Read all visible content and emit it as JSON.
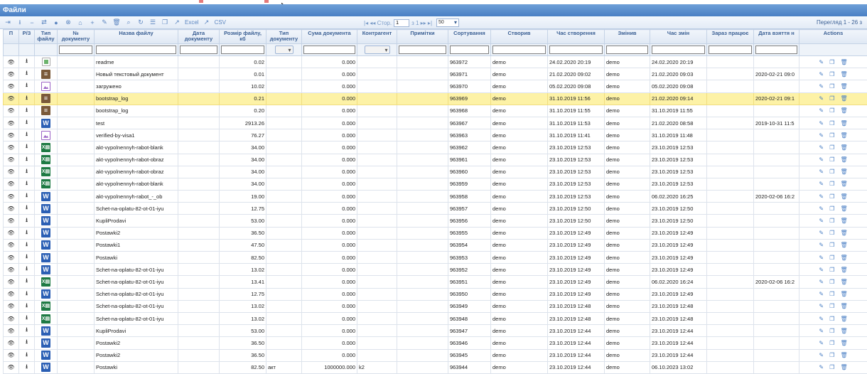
{
  "page": {
    "title": "Файли"
  },
  "toolbar": {
    "excel": "Excel",
    "csv": "CSV",
    "page_label": "Стор.",
    "page_value": "1",
    "page_of": "з 1",
    "page_size": "50",
    "viewing": "Перегляд 1 - 26 з"
  },
  "columns": {
    "p": "П",
    "rz": "Р/З",
    "type": "Тип файлу",
    "docnum": "№ документу",
    "name": "Назва файлу",
    "docdate": "Дата документу",
    "size": "Розмір файлу, кб",
    "doctype": "Тип документу",
    "sum": "Сума документа",
    "counterparty": "Контрагент",
    "notes": "Примітки",
    "sort": "Сортування",
    "creator": "Створив",
    "created": "Час створення",
    "modifier": "Змінив",
    "modified": "Час змін",
    "working": "Зараз працює",
    "taken": "Дата взяття н",
    "actions": "Actions"
  },
  "rows": [
    {
      "type": "broken",
      "name": "readme",
      "size": "0.02",
      "doctype": "",
      "sum": "0.000",
      "counterparty": "",
      "sort": "963972",
      "creator": "demo",
      "created": "24.02.2020 20:19",
      "modifier": "demo",
      "modified": "24.02.2020 20:19",
      "taken": ""
    },
    {
      "type": "txt",
      "name": "Новый текстовый документ",
      "size": "0.01",
      "doctype": "",
      "sum": "0.000",
      "counterparty": "",
      "sort": "963971",
      "creator": "demo",
      "created": "21.02.2020 09:02",
      "modifier": "demo",
      "modified": "21.02.2020 09:03",
      "taken": "2020-02-21 09:0"
    },
    {
      "type": "img",
      "name": "загружено",
      "size": "10.02",
      "doctype": "",
      "sum": "0.000",
      "counterparty": "",
      "sort": "963970",
      "creator": "demo",
      "created": "05.02.2020 09:08",
      "modifier": "demo",
      "modified": "05.02.2020 09:08",
      "taken": ""
    },
    {
      "type": "txt",
      "name": "bootstrap_log",
      "size": "0.21",
      "doctype": "",
      "sum": "0.000",
      "counterparty": "",
      "sort": "963969",
      "creator": "demo",
      "created": "31.10.2019 11:56",
      "modifier": "demo",
      "modified": "21.02.2020 09:14",
      "taken": "2020-02-21 09:1",
      "selected": true
    },
    {
      "type": "txt",
      "name": "bootstrap_log",
      "size": "0.20",
      "doctype": "",
      "sum": "0.000",
      "counterparty": "",
      "sort": "963968",
      "creator": "demo",
      "created": "31.10.2019 11:55",
      "modifier": "demo",
      "modified": "31.10.2019 11:55",
      "taken": ""
    },
    {
      "type": "doc",
      "name": "test",
      "size": "2913.26",
      "doctype": "",
      "sum": "0.000",
      "counterparty": "",
      "sort": "963967",
      "creator": "demo",
      "created": "31.10.2019 11:53",
      "modifier": "demo",
      "modified": "21.02.2020 08:58",
      "taken": "2019-10-31 11:5"
    },
    {
      "type": "img",
      "name": "verified-by-visa1",
      "size": "76.27",
      "doctype": "",
      "sum": "0.000",
      "counterparty": "",
      "sort": "963963",
      "creator": "demo",
      "created": "31.10.2019 11:41",
      "modifier": "demo",
      "modified": "31.10.2019 11:48",
      "taken": ""
    },
    {
      "type": "xls",
      "name": "akt-vypolnennyh-rabot-blank",
      "size": "34.00",
      "doctype": "",
      "sum": "0.000",
      "counterparty": "",
      "sort": "963962",
      "creator": "demo",
      "created": "23.10.2019 12:53",
      "modifier": "demo",
      "modified": "23.10.2019 12:53",
      "taken": ""
    },
    {
      "type": "xls",
      "name": "akt-vypolnennyh-rabot-obraz",
      "size": "34.00",
      "doctype": "",
      "sum": "0.000",
      "counterparty": "",
      "sort": "963961",
      "creator": "demo",
      "created": "23.10.2019 12:53",
      "modifier": "demo",
      "modified": "23.10.2019 12:53",
      "taken": ""
    },
    {
      "type": "xls",
      "name": "akt-vypolnennyh-rabot-obraz",
      "size": "34.00",
      "doctype": "",
      "sum": "0.000",
      "counterparty": "",
      "sort": "963960",
      "creator": "demo",
      "created": "23.10.2019 12:53",
      "modifier": "demo",
      "modified": "23.10.2019 12:53",
      "taken": ""
    },
    {
      "type": "xls",
      "name": "akt-vypolnennyh-rabot-blank",
      "size": "34.00",
      "doctype": "",
      "sum": "0.000",
      "counterparty": "",
      "sort": "963959",
      "creator": "demo",
      "created": "23.10.2019 12:53",
      "modifier": "demo",
      "modified": "23.10.2019 12:53",
      "taken": ""
    },
    {
      "type": "doc",
      "name": "akt-vypolnennyh-rabot_-_ob",
      "size": "19.00",
      "doctype": "",
      "sum": "0.000",
      "counterparty": "",
      "sort": "963958",
      "creator": "demo",
      "created": "23.10.2019 12:53",
      "modifier": "demo",
      "modified": "06.02.2020 16:25",
      "taken": "2020-02-06 16:2"
    },
    {
      "type": "doc",
      "name": "Schet-na-oplatu-82-ot-01-iyu",
      "size": "12.75",
      "doctype": "",
      "sum": "0.000",
      "counterparty": "",
      "sort": "963957",
      "creator": "demo",
      "created": "23.10.2019 12:50",
      "modifier": "demo",
      "modified": "23.10.2019 12:50",
      "taken": ""
    },
    {
      "type": "doc",
      "name": "KupliProdavi",
      "size": "53.00",
      "doctype": "",
      "sum": "0.000",
      "counterparty": "",
      "sort": "963956",
      "creator": "demo",
      "created": "23.10.2019 12:50",
      "modifier": "demo",
      "modified": "23.10.2019 12:50",
      "taken": ""
    },
    {
      "type": "doc",
      "name": "Postawki2",
      "size": "36.50",
      "doctype": "",
      "sum": "0.000",
      "counterparty": "",
      "sort": "963955",
      "creator": "demo",
      "created": "23.10.2019 12:49",
      "modifier": "demo",
      "modified": "23.10.2019 12:49",
      "taken": ""
    },
    {
      "type": "doc",
      "name": "Postawki1",
      "size": "47.50",
      "doctype": "",
      "sum": "0.000",
      "counterparty": "",
      "sort": "963954",
      "creator": "demo",
      "created": "23.10.2019 12:49",
      "modifier": "demo",
      "modified": "23.10.2019 12:49",
      "taken": ""
    },
    {
      "type": "doc",
      "name": "Postawki",
      "size": "82.50",
      "doctype": "",
      "sum": "0.000",
      "counterparty": "",
      "sort": "963953",
      "creator": "demo",
      "created": "23.10.2019 12:49",
      "modifier": "demo",
      "modified": "23.10.2019 12:49",
      "taken": ""
    },
    {
      "type": "doc",
      "name": "Schet-na-oplatu-82-ot-01-iyu",
      "size": "13.02",
      "doctype": "",
      "sum": "0.000",
      "counterparty": "",
      "sort": "963952",
      "creator": "demo",
      "created": "23.10.2019 12:49",
      "modifier": "demo",
      "modified": "23.10.2019 12:49",
      "taken": ""
    },
    {
      "type": "xls",
      "name": "Schet-na-oplatu-82-ot-01-iyu",
      "size": "13.41",
      "doctype": "",
      "sum": "0.000",
      "counterparty": "",
      "sort": "963951",
      "creator": "demo",
      "created": "23.10.2019 12:49",
      "modifier": "demo",
      "modified": "06.02.2020 16:24",
      "taken": "2020-02-06 16:2"
    },
    {
      "type": "doc",
      "name": "Schet-na-oplatu-82-ot-01-iyu",
      "size": "12.75",
      "doctype": "",
      "sum": "0.000",
      "counterparty": "",
      "sort": "963950",
      "creator": "demo",
      "created": "23.10.2019 12:49",
      "modifier": "demo",
      "modified": "23.10.2019 12:49",
      "taken": ""
    },
    {
      "type": "xls",
      "name": "Schet-na-oplatu-82-ot-01-iyu",
      "size": "13.02",
      "doctype": "",
      "sum": "0.000",
      "counterparty": "",
      "sort": "963949",
      "creator": "demo",
      "created": "23.10.2019 12:48",
      "modifier": "demo",
      "modified": "23.10.2019 12:48",
      "taken": ""
    },
    {
      "type": "xls",
      "name": "Schet-na-oplatu-82-ot-01-iyu",
      "size": "13.02",
      "doctype": "",
      "sum": "0.000",
      "counterparty": "",
      "sort": "963948",
      "creator": "demo",
      "created": "23.10.2019 12:48",
      "modifier": "demo",
      "modified": "23.10.2019 12:48",
      "taken": ""
    },
    {
      "type": "doc",
      "name": "KupliProdavi",
      "size": "53.00",
      "doctype": "",
      "sum": "0.000",
      "counterparty": "",
      "sort": "963947",
      "creator": "demo",
      "created": "23.10.2019 12:44",
      "modifier": "demo",
      "modified": "23.10.2019 12:44",
      "taken": ""
    },
    {
      "type": "doc",
      "name": "Postawki2",
      "size": "36.50",
      "doctype": "",
      "sum": "0.000",
      "counterparty": "",
      "sort": "963946",
      "creator": "demo",
      "created": "23.10.2019 12:44",
      "modifier": "demo",
      "modified": "23.10.2019 12:44",
      "taken": ""
    },
    {
      "type": "doc",
      "name": "Postawki2",
      "size": "36.50",
      "doctype": "",
      "sum": "0.000",
      "counterparty": "",
      "sort": "963945",
      "creator": "demo",
      "created": "23.10.2019 12:44",
      "modifier": "demo",
      "modified": "23.10.2019 12:44",
      "taken": ""
    },
    {
      "type": "doc",
      "name": "Postawki",
      "size": "82.50",
      "doctype": "акт",
      "sum": "1000000.000",
      "counterparty": "k2",
      "sort": "963944",
      "creator": "demo",
      "created": "23.10.2019 12:44",
      "modifier": "demo",
      "modified": "06.10.2023 13:02",
      "taken": ""
    }
  ]
}
